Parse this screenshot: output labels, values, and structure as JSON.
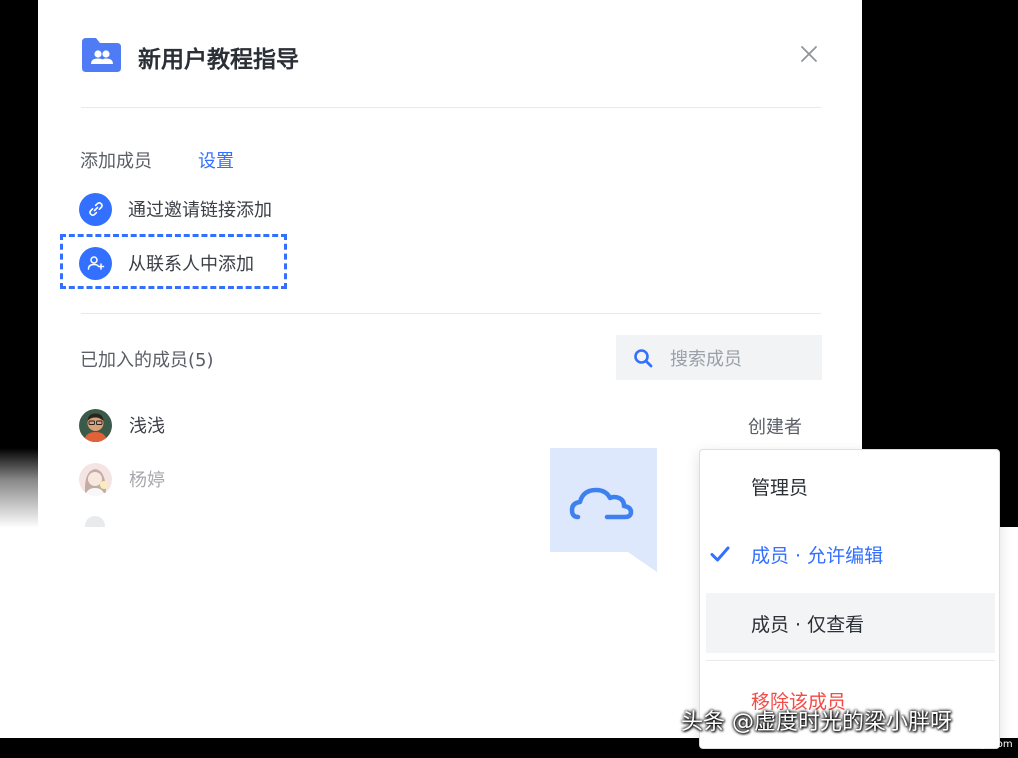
{
  "dialog": {
    "title": "新用户教程指导",
    "add_section_label": "添加成员",
    "settings_link": "设置",
    "options": [
      {
        "label": "通过邀请链接添加"
      },
      {
        "label": "从联系人中添加"
      }
    ],
    "members_title": "已加入的成员(5)",
    "search_placeholder": "搜索成员",
    "members": [
      {
        "name": "浅浅",
        "role": "创建者"
      },
      {
        "name": "杨婷"
      }
    ]
  },
  "role_menu": {
    "items": [
      {
        "label": "管理员"
      },
      {
        "label": "成员 · 允许编辑",
        "selected": true
      },
      {
        "label": "成员 · 仅查看"
      },
      {
        "label": "移除该成员"
      }
    ]
  },
  "watermark": {
    "text": "头条 @虚度时光的梁小胖呀",
    "site": "www.dnzp.com"
  },
  "colors": {
    "accent": "#3370ff",
    "danger": "#f54a45",
    "text": "#2b2f36"
  }
}
